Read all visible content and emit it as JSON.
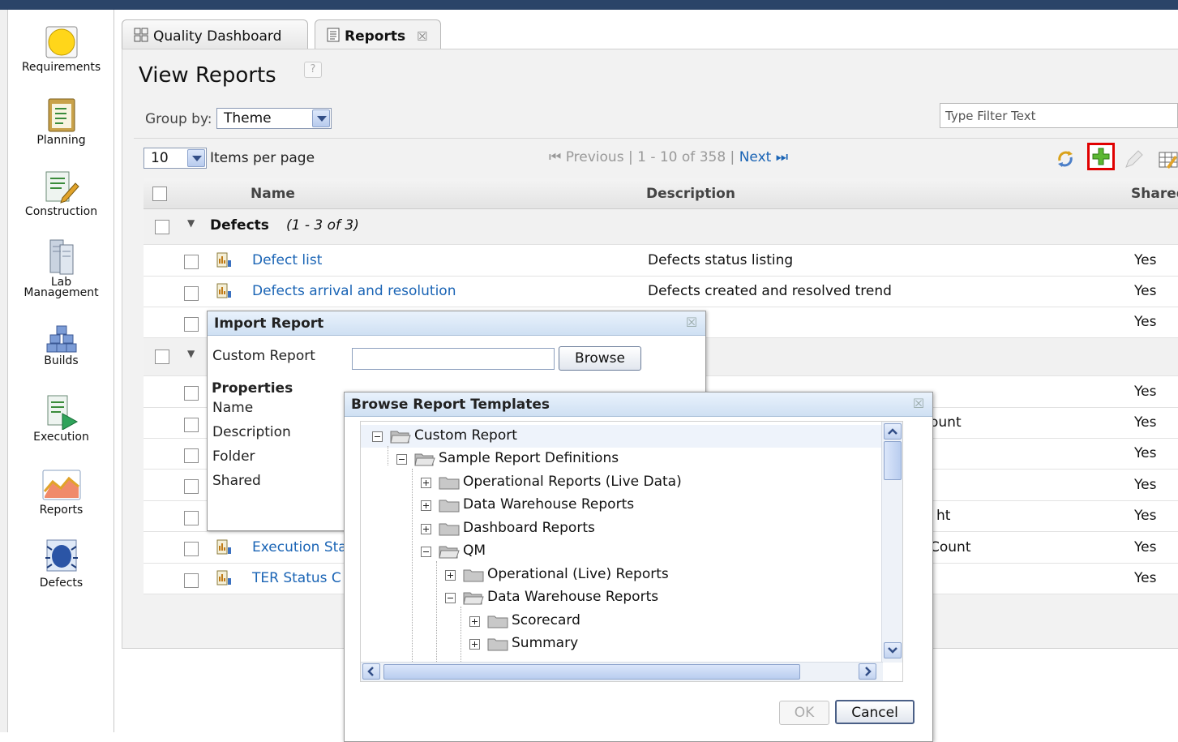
{
  "nav": [
    {
      "label": "Requirements",
      "icon": "requirements-icon"
    },
    {
      "label": "Planning",
      "icon": "planning-icon"
    },
    {
      "label": "Construction",
      "icon": "construction-icon"
    },
    {
      "label": "Lab Management",
      "icon": "lab-management-icon"
    },
    {
      "label": "Builds",
      "icon": "builds-icon"
    },
    {
      "label": "Execution",
      "icon": "execution-icon"
    },
    {
      "label": "Reports",
      "icon": "reports-icon"
    },
    {
      "label": "Defects",
      "icon": "defects-icon"
    }
  ],
  "tabs": [
    {
      "label": "Quality Dashboard",
      "icon": "dashboard-icon"
    },
    {
      "label": "Reports",
      "icon": "reports-tab-icon",
      "active": true
    }
  ],
  "page": {
    "title": "View Reports",
    "help": "?",
    "group_by_label": "Group by:",
    "group_by_value": "Theme",
    "filter_placeholder": "Type Filter Text",
    "items_per_page_value": "10",
    "items_per_page_label": "Items per page",
    "pager": {
      "previous": "Previous",
      "range": "1 - 10 of 358",
      "next": "Next"
    }
  },
  "table": {
    "columns": [
      "Name",
      "Description",
      "Shared"
    ],
    "groups": [
      {
        "name": "Defects",
        "count": "(1 - 3 of 3)"
      }
    ],
    "rows": [
      {
        "name": "Defect list",
        "description": "Defects status listing",
        "shared": "Yes"
      },
      {
        "name": "Defects arrival and resolution",
        "description": "Defects created and resolved trend",
        "shared": "Yes"
      },
      {
        "name": "",
        "description": "",
        "shared": "Yes"
      },
      {
        "name": "",
        "description": "",
        "shared": "Yes"
      },
      {
        "name": "",
        "description": "ount",
        "shared": "Yes"
      },
      {
        "name": "",
        "description": "",
        "shared": "Yes"
      },
      {
        "name": "",
        "description": "",
        "shared": "Yes"
      },
      {
        "name": "",
        "description": "ht",
        "shared": "Yes"
      },
      {
        "name": "Execution Sta",
        "description": "Count",
        "shared": "Yes"
      },
      {
        "name": "TER Status C",
        "description": "",
        "shared": "Yes"
      }
    ]
  },
  "import_dialog": {
    "title": "Import Report",
    "custom_report_label": "Custom Report",
    "browse_label": "Browse",
    "properties_label": "Properties",
    "fields": [
      "Name",
      "Description",
      "Folder",
      "Shared"
    ]
  },
  "browse_dialog": {
    "title": "Browse Report Templates",
    "tree": [
      {
        "label": "Custom Report",
        "level": 0,
        "expanded": true
      },
      {
        "label": "Sample Report Definitions",
        "level": 1,
        "expanded": true
      },
      {
        "label": "Operational Reports (Live Data)",
        "level": 2,
        "expanded": false
      },
      {
        "label": "Data Warehouse Reports",
        "level": 2,
        "expanded": false
      },
      {
        "label": "Dashboard Reports",
        "level": 2,
        "expanded": false
      },
      {
        "label": "QM",
        "level": 2,
        "expanded": true
      },
      {
        "label": "Operational (Live) Reports",
        "level": 3,
        "expanded": false
      },
      {
        "label": "Data Warehouse Reports",
        "level": 3,
        "expanded": true
      },
      {
        "label": "Scorecard",
        "level": 4,
        "expanded": false
      },
      {
        "label": "Summary",
        "level": 4,
        "expanded": false
      }
    ],
    "ok_label": "OK",
    "cancel_label": "Cancel"
  },
  "colors": {
    "accent_link": "#1a64b5",
    "top_bar": "#2b4468",
    "add_highlight": "#e00000"
  }
}
